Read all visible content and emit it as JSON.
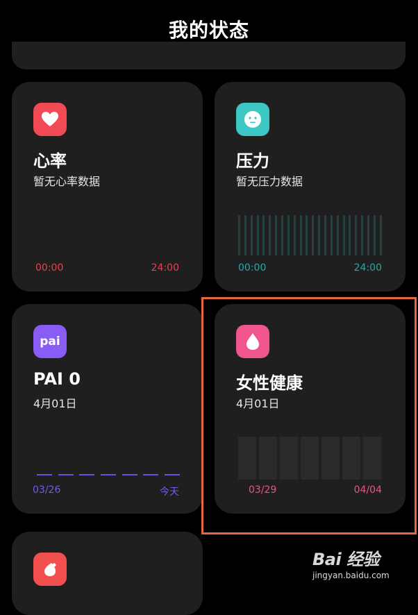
{
  "header": {
    "title": "我的状态"
  },
  "cards": {
    "heart_rate": {
      "title": "心率",
      "subtitle": "暂无心率数据",
      "axis_start": "00:00",
      "axis_end": "24:00",
      "icon": "heart-icon",
      "icon_color": "#f24a55",
      "accent_color": "#e8424e"
    },
    "stress": {
      "title": "压力",
      "subtitle": "暂无压力数据",
      "axis_start": "00:00",
      "axis_end": "24:00",
      "icon": "face-icon",
      "icon_color": "#3cc7c5",
      "accent_color": "#2aa8a8"
    },
    "pai": {
      "title": "PAI 0",
      "subtitle": "4月01日",
      "icon_text": "pai",
      "axis_start": "03/26",
      "axis_end": "今天",
      "icon": "pai-icon",
      "icon_color": "#8a5cf6",
      "accent_color": "#7a58e8"
    },
    "women_health": {
      "title": "女性健康",
      "subtitle": "4月01日",
      "axis_start": "03/29",
      "axis_end": "04/04",
      "icon": "drop-icon",
      "icon_color": "#f0568d",
      "accent_color": "#e8558c"
    },
    "next_card": {
      "icon": "drop-icon",
      "icon_color": "#f2504e"
    }
  },
  "watermark": {
    "logo": "Bai 经验",
    "url": "jingyan.baidu.com"
  },
  "highlight_color": "#e8663c"
}
